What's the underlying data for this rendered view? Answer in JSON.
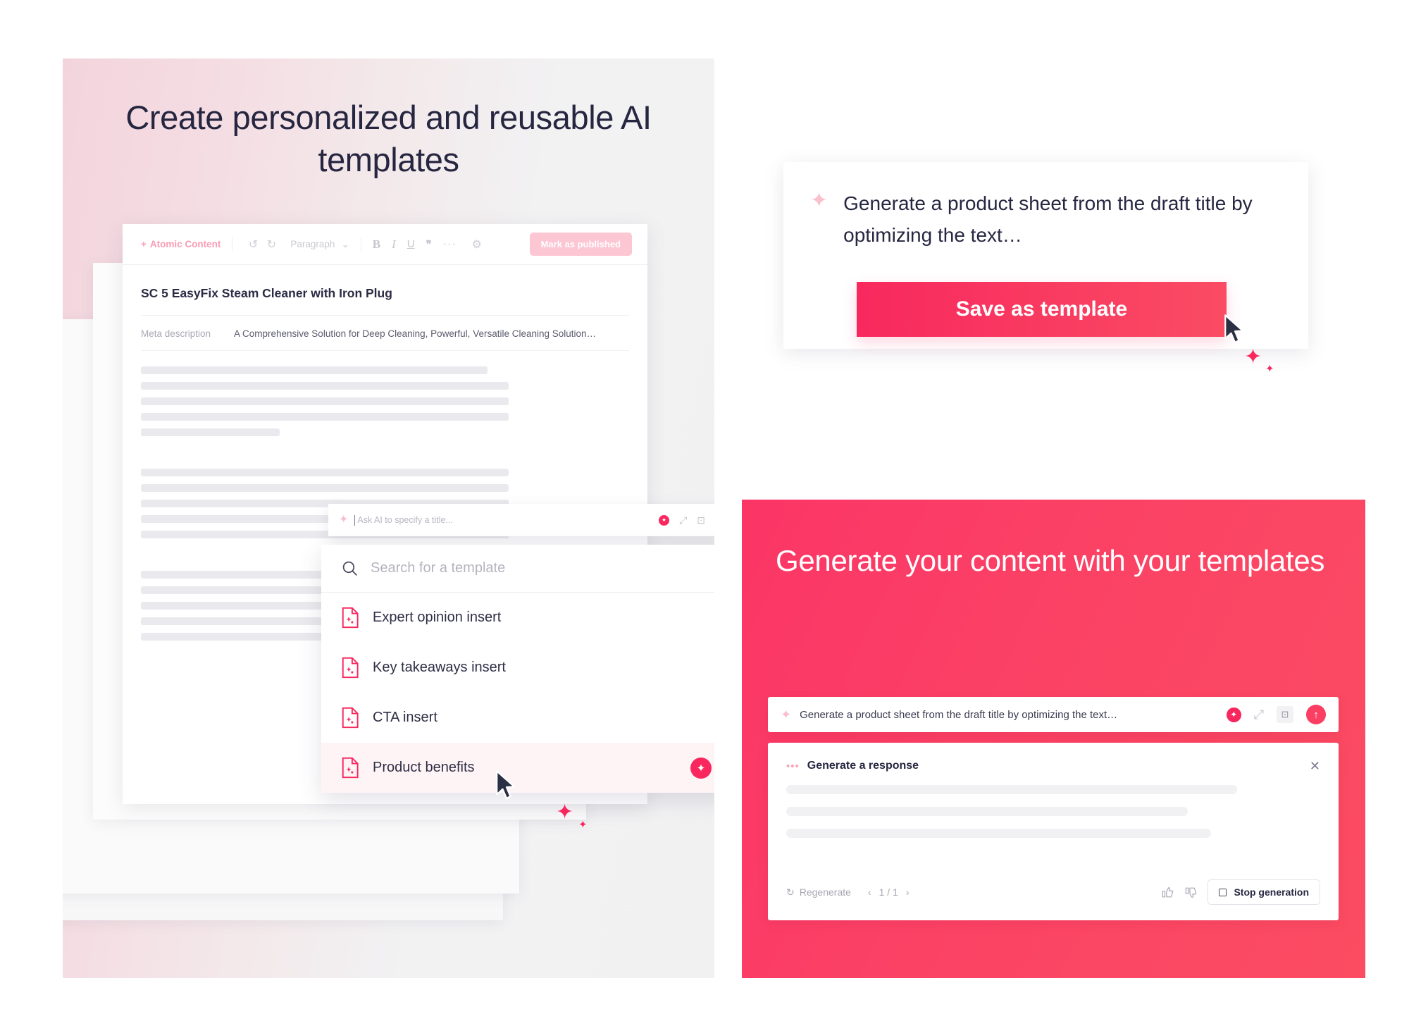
{
  "left_panel": {
    "hero_title": "Create personalized and reusable AI templates",
    "editor": {
      "toolbar": {
        "atomic_content_label": "Atomic Content",
        "atomic_plus": "+",
        "undo_icon": "↺",
        "redo_icon": "↻",
        "paragraph_label": "Paragraph",
        "chevron_icon": "⌄",
        "bold_label": "B",
        "italic_label": "I",
        "underline_label": "U",
        "quote_label": "❞",
        "more_label": "···",
        "gear_icon": "⚙",
        "publish_label": "Mark as published"
      },
      "document_title": "SC 5 EasyFix Steam Cleaner with Iron Plug",
      "meta_label": "Meta description",
      "meta_value": "A Comprehensive Solution for Deep Cleaning, Powerful, Versatile Cleaning Solution…"
    },
    "ai_bar": {
      "placeholder": "Ask AI to specify a title...",
      "sparkle_icon": "✦",
      "expand_icon": "⤢",
      "capture_icon": "⊡"
    },
    "template_dropdown": {
      "search_placeholder": "Search for a template",
      "search_icon": "search-icon",
      "items": [
        {
          "label": "Expert opinion insert",
          "active": false
        },
        {
          "label": "Key takeaways insert",
          "active": false
        },
        {
          "label": "CTA insert",
          "active": false
        },
        {
          "label": "Product benefits",
          "active": true
        }
      ],
      "cta_icon": "✦"
    }
  },
  "top_right_card": {
    "sparkle_icon": "✦",
    "prompt_text": "Generate a product sheet from the draft title by optimizing the text…",
    "save_button_label": "Save as template"
  },
  "bottom_right_panel": {
    "title": "Generate your content with your templates",
    "prompt": {
      "sparkle_icon": "✦",
      "text": "Generate a product sheet from the draft title by optimizing the text…",
      "expand_icon": "⤢",
      "capture_icon": "⊡",
      "send_icon": "↑"
    },
    "response": {
      "dots_icon": "•••",
      "title": "Generate a response",
      "close_icon": "✕",
      "regenerate_label": "Regenerate",
      "regenerate_icon": "↻",
      "prev_icon": "‹",
      "page_indicator": "1 / 1",
      "next_icon": "›",
      "thumb_up_icon": "👍",
      "thumb_down_icon": "👎",
      "stop_label": "Stop generation"
    }
  },
  "colors": {
    "accent_pink": "#f8285e",
    "accent_light_pink": "#fcc6d3",
    "text_dark": "#262641",
    "skeleton_grey": "#eaeaee"
  }
}
